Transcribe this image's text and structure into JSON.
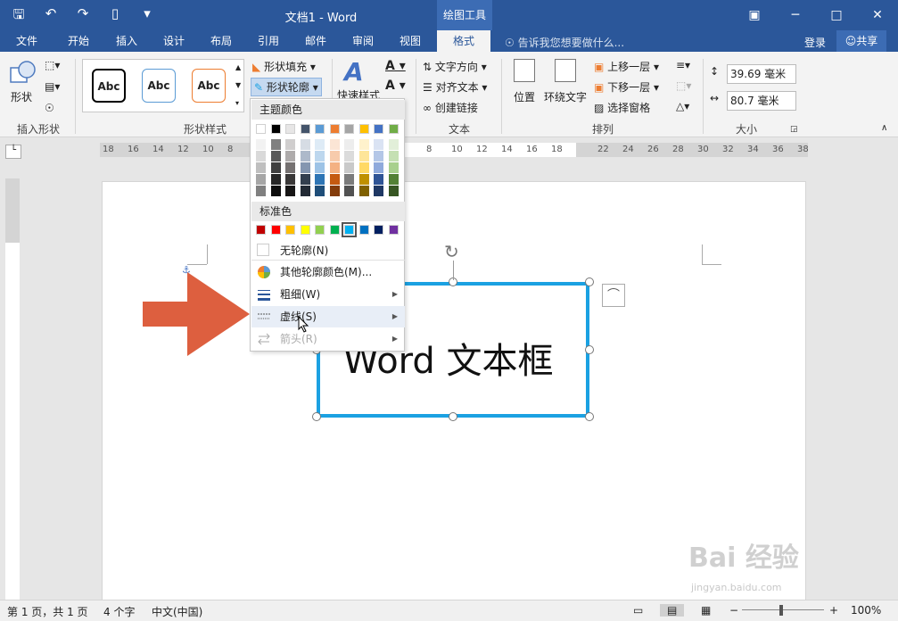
{
  "title_bar": {
    "doc_title": "文档1 - Word",
    "context_tab": "绘图工具",
    "qat_icons": [
      "save-icon",
      "undo-icon",
      "redo-icon",
      "new-doc-icon",
      "customize-icon"
    ],
    "window_controls": [
      "ribbon-display-icon",
      "minimize-icon",
      "maximize-icon",
      "close-icon"
    ]
  },
  "tabs": [
    {
      "label": "文件"
    },
    {
      "label": "开始"
    },
    {
      "label": "插入"
    },
    {
      "label": "设计"
    },
    {
      "label": "布局"
    },
    {
      "label": "引用"
    },
    {
      "label": "邮件"
    },
    {
      "label": "审阅"
    },
    {
      "label": "视图"
    },
    {
      "label": "格式",
      "active": true
    }
  ],
  "tell_me": "告诉我您想要做什么...",
  "login": "登录",
  "share": "共享",
  "ribbon": {
    "insert_shapes": {
      "shape_label": "形状",
      "group": "插入形状"
    },
    "shape_styles": {
      "thumbs": [
        {
          "label": "Abc",
          "border": "#000000"
        },
        {
          "label": "Abc",
          "border": "#5b9bd5"
        },
        {
          "label": "Abc",
          "border": "#ed7d31"
        }
      ],
      "fill": "形状填充",
      "outline": "形状轮廓",
      "quick_styles": "快速样式",
      "group": "形状样式"
    },
    "text": {
      "direction": "文字方向",
      "align": "对齐文本",
      "link": "创建链接",
      "group": "文本"
    },
    "arrange": {
      "position": "位置",
      "wrap": "环绕文字",
      "forward": "上移一层",
      "backward": "下移一层",
      "pane": "选择窗格",
      "group": "排列"
    },
    "size": {
      "height": "39.69 毫米",
      "width": "80.7 毫米",
      "group": "大小"
    }
  },
  "ruler_labels": {
    "left": [
      "18",
      "16",
      "14",
      "12",
      "10",
      "8"
    ],
    "middle": [
      "8",
      "10",
      "12",
      "14",
      "16",
      "18"
    ],
    "right": [
      "22",
      "24",
      "26",
      "28",
      "30",
      "32",
      "34",
      "36",
      "38"
    ]
  },
  "document": {
    "textbox_text": "Word 文本框"
  },
  "outline_menu": {
    "theme_header": "主题颜色",
    "standard_header": "标准色",
    "theme_top_row": [
      "#ffffff",
      "#000000",
      "#e7e6e6",
      "#44546a",
      "#5b9bd5",
      "#ed7d31",
      "#a5a5a5",
      "#ffc000",
      "#4472c4",
      "#70ad47"
    ],
    "theme_columns": [
      [
        "#f2f2f2",
        "#d9d9d9",
        "#bfbfbf",
        "#a6a6a6",
        "#808080"
      ],
      [
        "#808080",
        "#595959",
        "#404040",
        "#262626",
        "#0d0d0d"
      ],
      [
        "#d0cece",
        "#aeabab",
        "#757171",
        "#3a3838",
        "#171616"
      ],
      [
        "#d6dce4",
        "#adb9ca",
        "#8496b0",
        "#333f4f",
        "#222a35"
      ],
      [
        "#deebf6",
        "#bdd7ee",
        "#9dc3e6",
        "#2e75b5",
        "#1f4e79"
      ],
      [
        "#fbe5d5",
        "#f7cbac",
        "#f4b183",
        "#c55a11",
        "#843c0b"
      ],
      [
        "#ededed",
        "#dbdbdb",
        "#c9c9c9",
        "#7b7b7b",
        "#525252"
      ],
      [
        "#fff2cc",
        "#fee599",
        "#ffd965",
        "#bf9000",
        "#7f6000"
      ],
      [
        "#dae3f3",
        "#b4c7e7",
        "#8faadc",
        "#2f5496",
        "#1f3864"
      ],
      [
        "#e2efd9",
        "#c5e0b3",
        "#a8d08d",
        "#538135",
        "#375623"
      ]
    ],
    "standard_colors": [
      "#c00000",
      "#ff0000",
      "#ffc000",
      "#ffff00",
      "#92d050",
      "#00b050",
      "#00b0f0",
      "#0070c0",
      "#002060",
      "#7030a0"
    ],
    "selected_standard_index": 6,
    "items": [
      {
        "label": "无轮廓(N)",
        "icon": "no-outline-icon",
        "submenu": false,
        "disabled": false
      },
      {
        "label": "其他轮廓颜色(M)...",
        "icon": "color-wheel-icon",
        "submenu": false,
        "disabled": false
      },
      {
        "label": "粗细(W)",
        "icon": "weight-icon",
        "submenu": true,
        "disabled": false
      },
      {
        "label": "虚线(S)",
        "icon": "dashes-icon",
        "submenu": true,
        "disabled": false
      },
      {
        "label": "箭头(R)",
        "icon": "arrows-icon",
        "submenu": true,
        "disabled": true
      }
    ]
  },
  "status_bar": {
    "page": "第 1 页，共 1 页",
    "words": "4 个字",
    "language": "中文(中国)",
    "zoom": "100%"
  },
  "watermark": {
    "main": "Bai 经验",
    "sub": "jingyan.baidu.com"
  },
  "colors": {
    "ribbon_blue": "#2b579a",
    "textbox_border": "#1ba1e2",
    "arrow": "#dd5f3f"
  }
}
